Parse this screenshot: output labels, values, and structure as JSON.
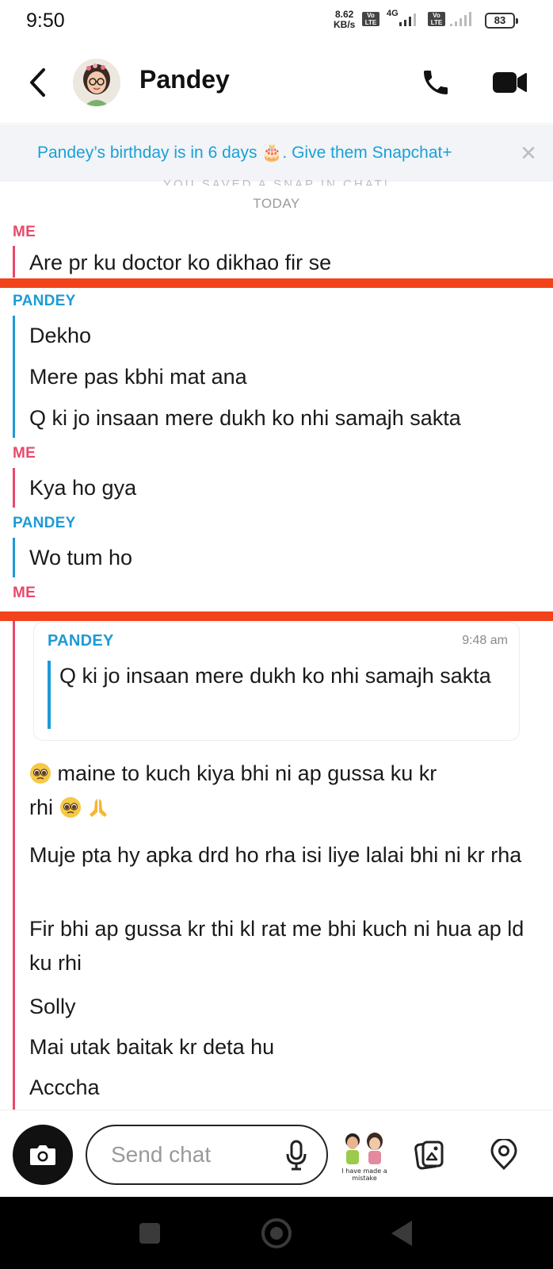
{
  "status_bar": {
    "time": "9:50",
    "speed_value": "8.62",
    "speed_unit": "KB/s",
    "volte_label": "Vo LTE",
    "network": "4G",
    "battery": "83"
  },
  "header": {
    "contact_name": "Pandey"
  },
  "banner": {
    "text": "Pandey’s birthday is in 6 days 🎂. Give them Snapchat+",
    "close": "✕"
  },
  "chat": {
    "saved_snap_notice": "YOU SAVED A SNAP IN CHAT!",
    "day_label": "TODAY",
    "me_label": "ME",
    "them_label": "PANDEY",
    "group1": [
      "Are pr ku doctor ko dikhao fir se"
    ],
    "group2": [
      "Dekho",
      "Mere pas kbhi mat ana",
      "Q ki jo insaan mere dukh ko nhi samajh sakta"
    ],
    "group3": [
      "Kya ho gya"
    ],
    "group4": [
      "Wo tum ho"
    ],
    "reply": {
      "sender": "PANDEY",
      "time": "9:48 am",
      "text": "Q ki jo insaan mere dukh ko nhi samajh sakta"
    },
    "group5": {
      "line1_a": "maine to kuch kiya bhi ni ap gussa ku kr",
      "line1_b": "rhi",
      "line2": "Muje pta hy apka drd ho rha isi liye lalai bhi ni kr rha",
      "line3": "Fir bhi ap gussa kr thi kl rat me bhi kuch ni hua ap ld ku rhi",
      "line4": "Solly",
      "line5": "Mai utak baitak kr deta hu",
      "line6": "Acccha"
    }
  },
  "composer": {
    "placeholder": "Send chat",
    "bitmoji_caption": "I have made a mistake"
  },
  "colors": {
    "me": "#e8496b",
    "them": "#1e9ad6",
    "highlight_line": "#f2421c",
    "banner_text": "#1aa0d8"
  },
  "icons": [
    "back-icon",
    "phone-icon",
    "video-icon",
    "camera-icon",
    "mic-icon",
    "gallery-icon",
    "location-icon",
    "cake-icon",
    "pleading-face-icon",
    "folded-hands-icon"
  ]
}
